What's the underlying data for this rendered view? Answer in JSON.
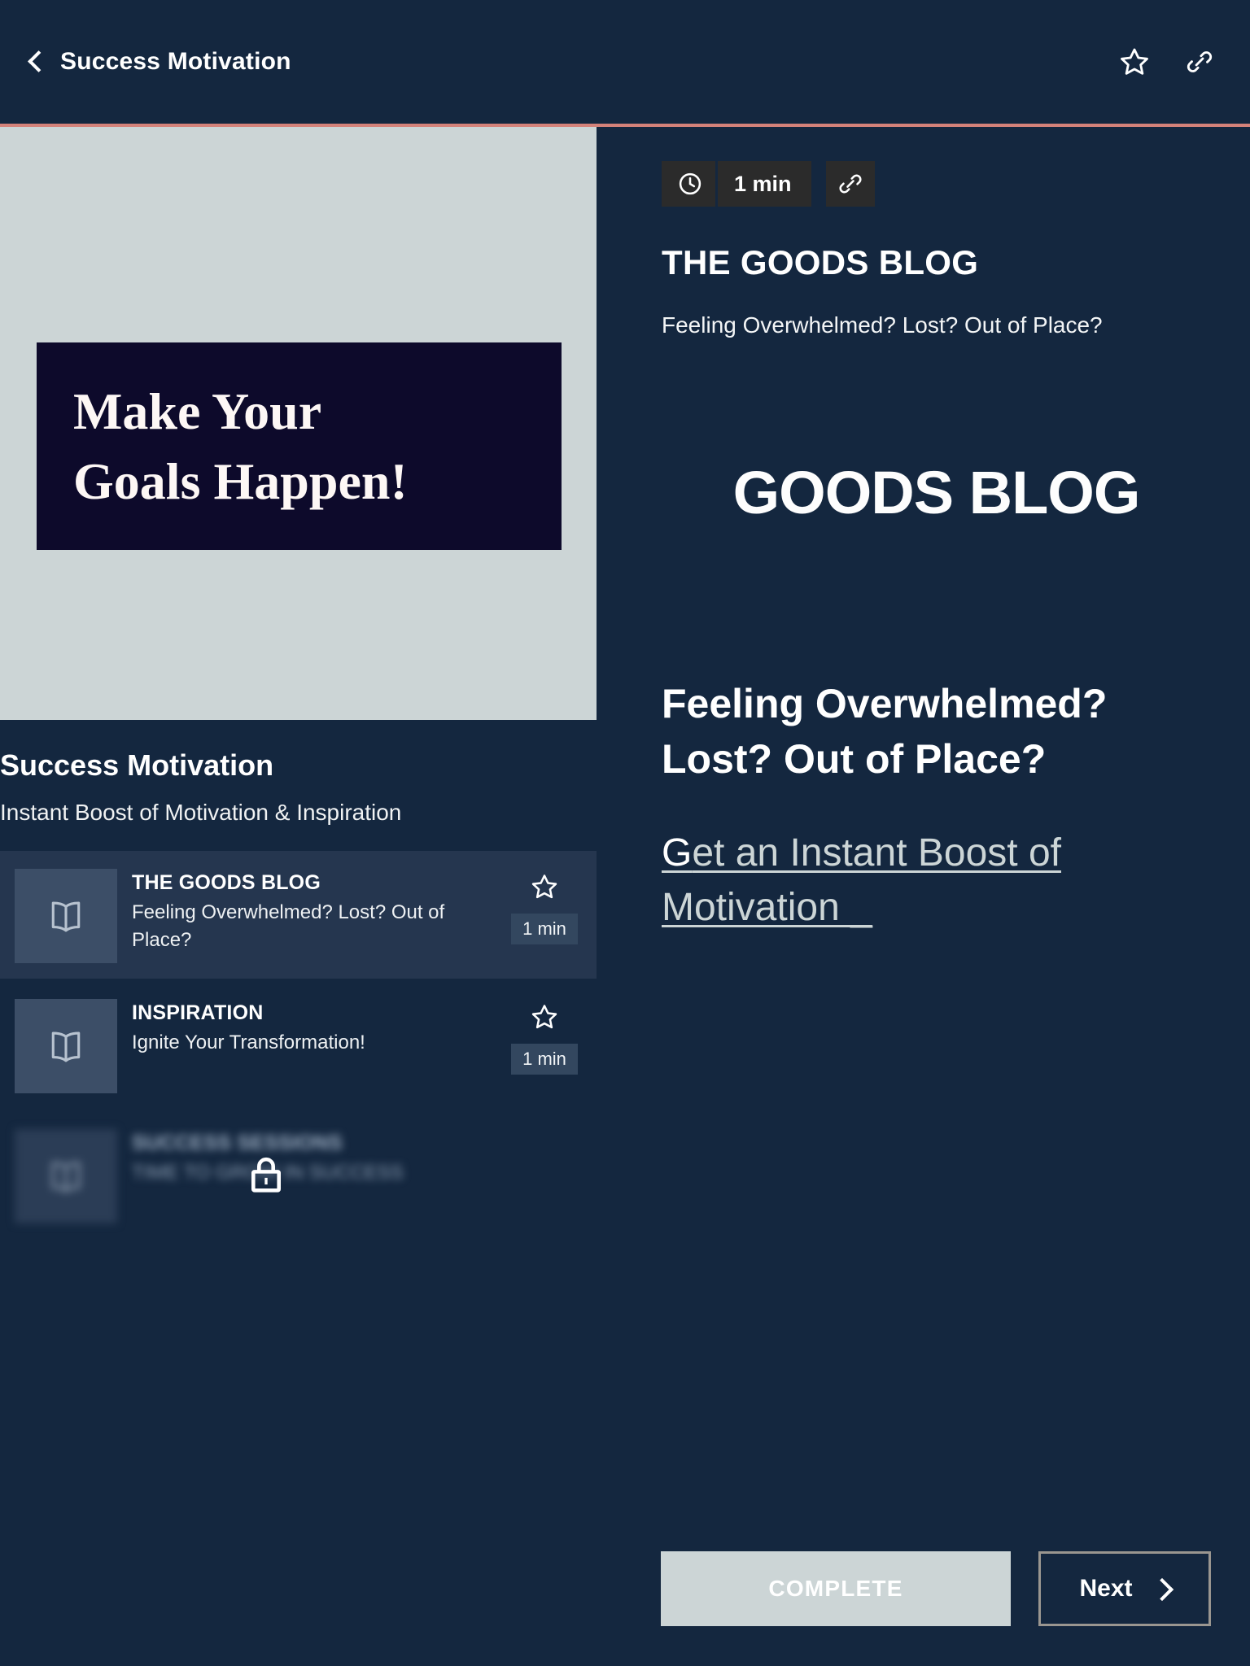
{
  "colors": {
    "background": "#14273f",
    "accent_line": "#d4827a",
    "panel_light": "#ccd5d6",
    "hero_box": "#0d0a2b",
    "active_row": "#25364f",
    "thumb": "#3c4e67",
    "pill_dark": "#2b2b2b",
    "next_border": "#9a9690",
    "link": "#ccd5d6"
  },
  "topbar": {
    "back_label": "back-chevron",
    "title": "Success Motivation",
    "star_icon": "star-icon",
    "link_icon": "link-icon"
  },
  "left": {
    "hero": {
      "line1": "Make Your",
      "line2": "Goals Happen!"
    },
    "course_title": "Success Motivation",
    "course_subtitle": "Instant Boost of Motivation & Inspiration",
    "lessons": [
      {
        "kicker": "THE GOODS BLOG",
        "desc": "Feeling Overwhelmed? Lost? Out of Place?",
        "duration": "1 min",
        "state": "active",
        "locked": false
      },
      {
        "kicker": "INSPIRATION",
        "desc": "Ignite Your Transformation!",
        "duration": "1 min",
        "state": "plain",
        "locked": false
      },
      {
        "kicker": "SUCCESS SESSIONS",
        "desc": "TIME TO GROW IN SUCCESS",
        "duration": "",
        "state": "locked",
        "locked": true
      }
    ]
  },
  "right": {
    "duration_badge": "1 min",
    "clock_icon": "clock-icon",
    "copy_link_icon": "link-icon",
    "blog_kicker": "THE GOODS BLOG",
    "blog_subtitle": "Feeling Overwhelmed? Lost? Out of Place?",
    "logo_text": "GOODS BLOG",
    "headline": "Feeling Overwhelmed? Lost? Out of Place?",
    "cta_lead": "G",
    "cta_rest": "et an Instant Boost of Motivation _"
  },
  "footer": {
    "complete_label": "COMPLETE",
    "next_label": "Next"
  }
}
